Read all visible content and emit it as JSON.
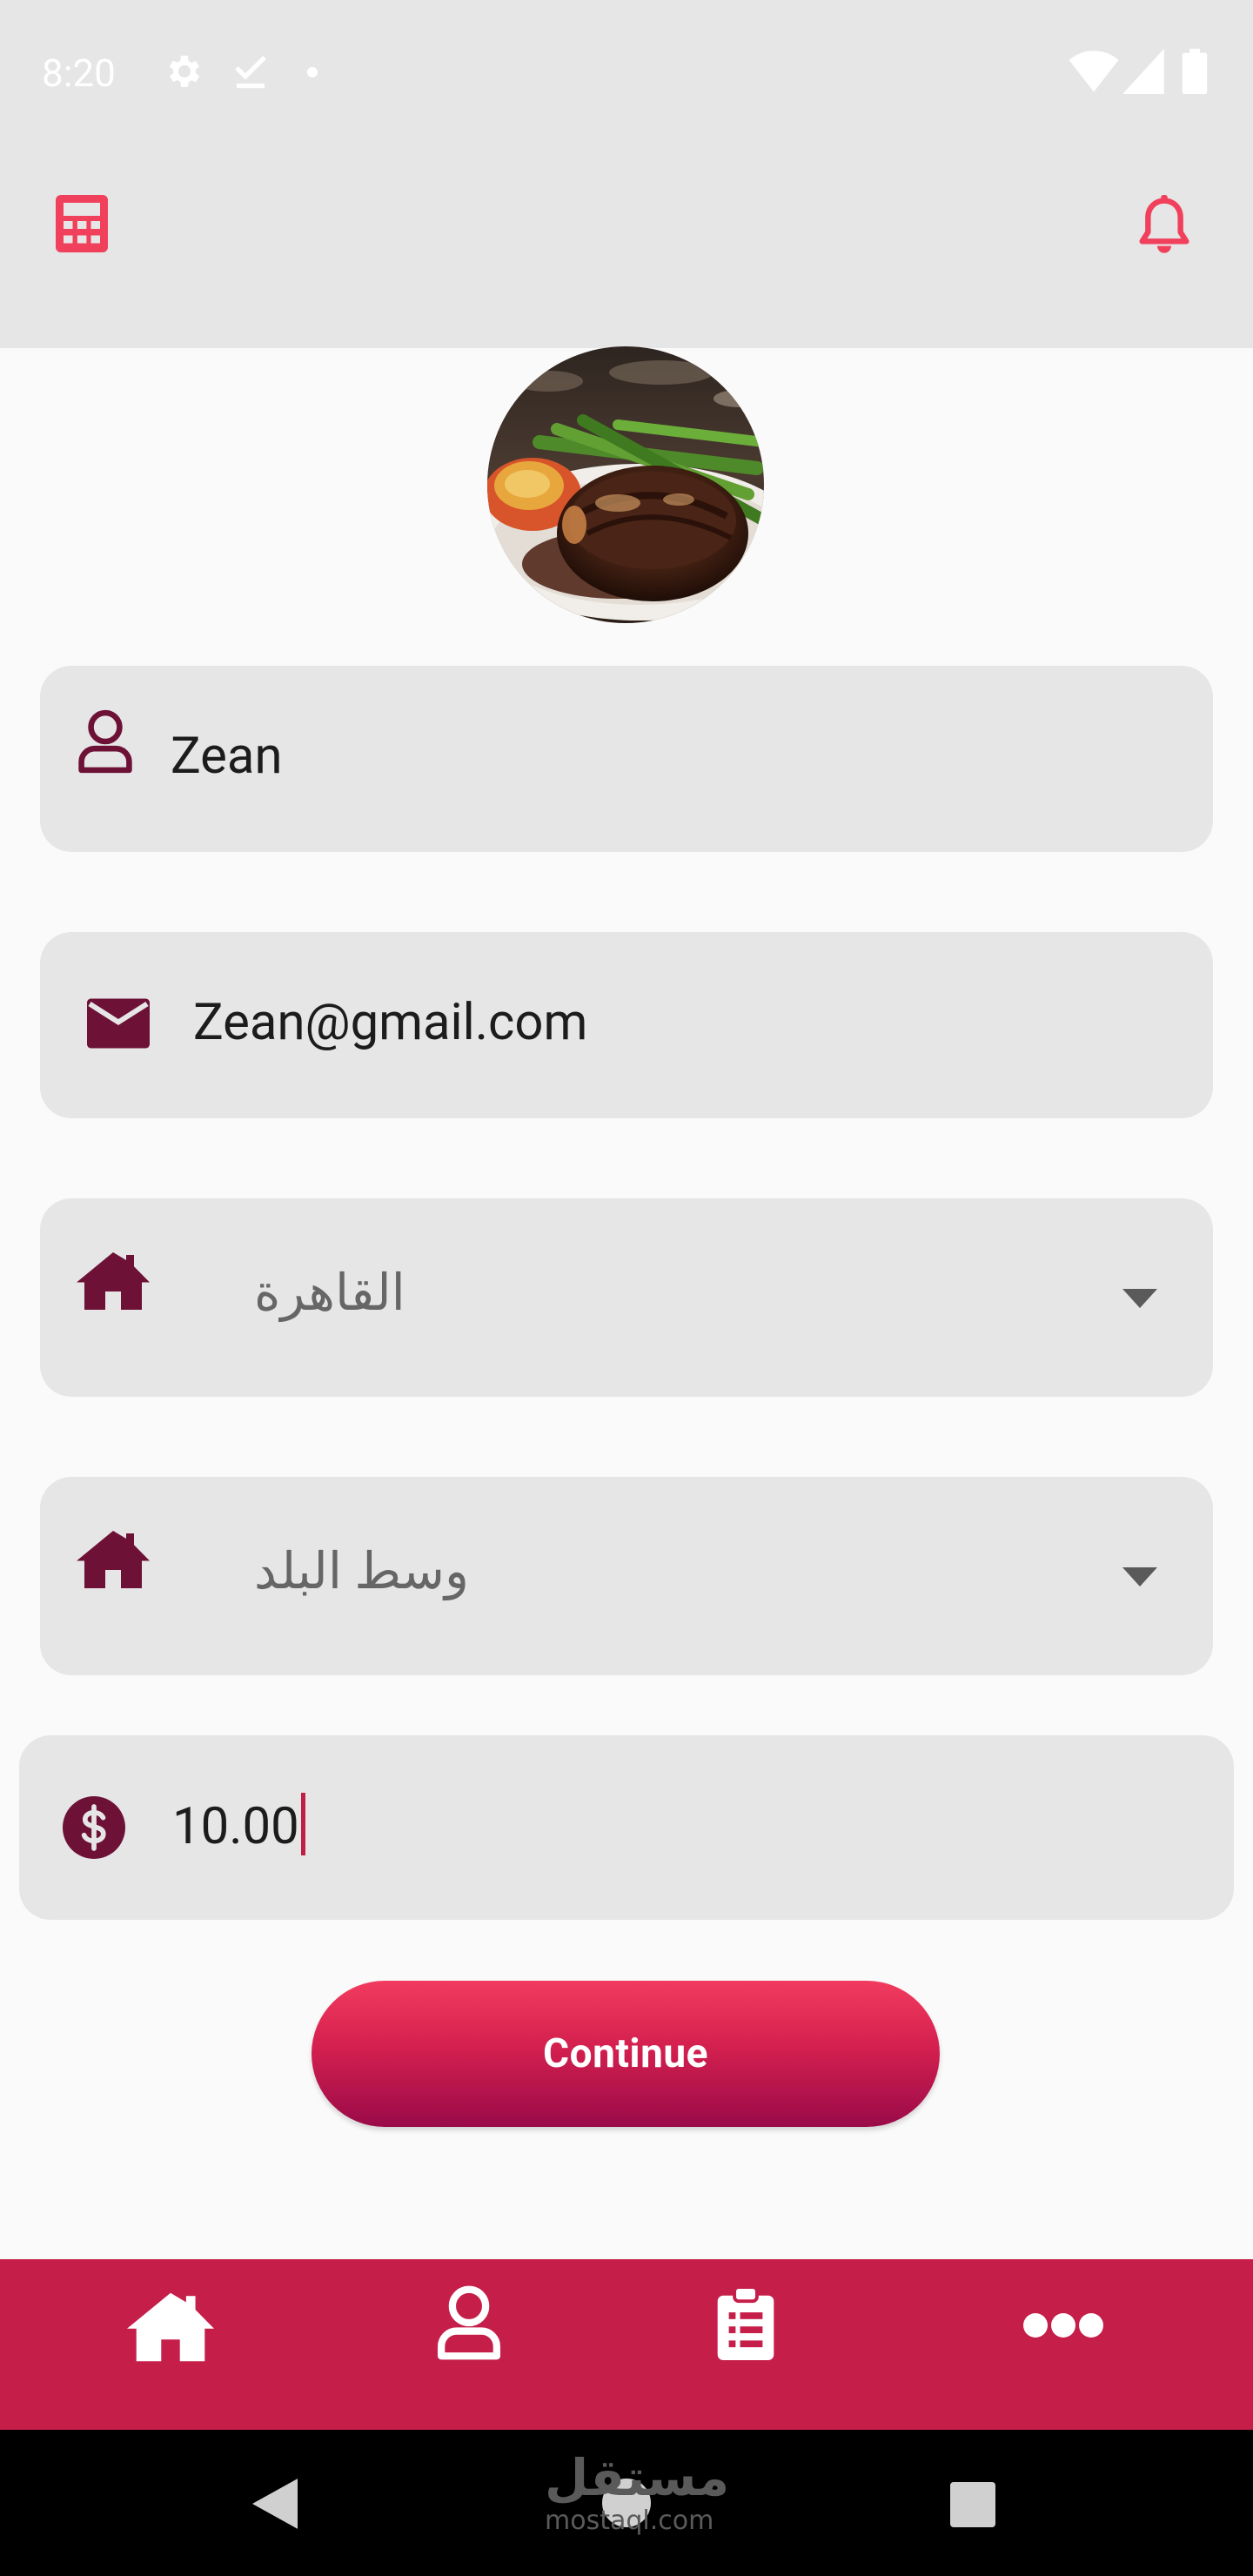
{
  "status_bar": {
    "time": "8:20",
    "left_icons": [
      "settings-icon",
      "download-done-icon",
      "dot-icon"
    ],
    "right_icons": [
      "wifi-icon",
      "signal-icon",
      "battery-icon"
    ]
  },
  "app_bar": {
    "left_icon": "calculator-icon",
    "right_icon": "bell-icon",
    "accent": "#f0405c"
  },
  "profile": {
    "avatar": "food-photo-steak"
  },
  "form": {
    "name": {
      "value": "Zean",
      "icon": "user-icon"
    },
    "email": {
      "value": "Zean@gmail.com",
      "icon": "envelope-icon"
    },
    "city": {
      "value": "القاهرة",
      "icon": "home-icon"
    },
    "district": {
      "value": "وسط البلد",
      "icon": "home-icon"
    },
    "amount": {
      "value": "10.00",
      "icon": "dollar-icon"
    },
    "icon_color": "#6d1136"
  },
  "actions": {
    "continue_label": "Continue"
  },
  "bottom_nav": {
    "background": "#c51e49",
    "items": [
      "home-icon",
      "user-icon",
      "clipboard-icon",
      "more-icon"
    ]
  },
  "system_nav": {
    "items": [
      "back-icon",
      "home-circle-icon",
      "recents-icon"
    ]
  },
  "watermark": {
    "arabic": "مستقل",
    "latin": "mostaql.com"
  }
}
